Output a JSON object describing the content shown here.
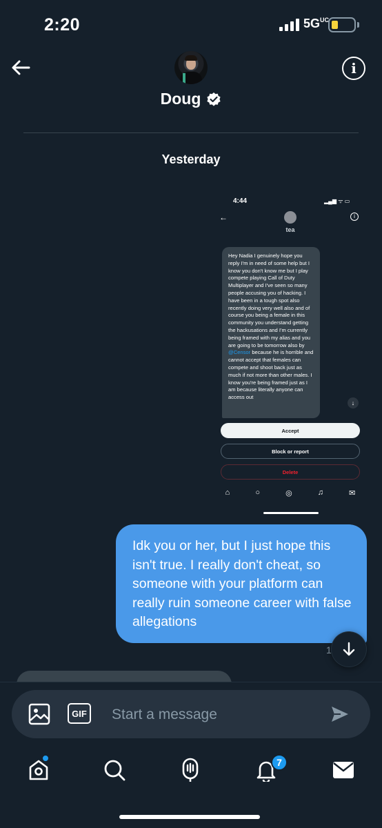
{
  "status_bar": {
    "time": "2:20",
    "network": "5G",
    "network_suffix": "UC"
  },
  "header": {
    "contact_name": "Doug",
    "verified": true
  },
  "conversation": {
    "day_label": "Yesterday",
    "attachment": {
      "status_time": "4:44",
      "contact_name": "tea",
      "message_before_mention": "Hey Nadia I genuinely hope you reply I'm in need of some help but I know you don't know me but I play compete playing Call of Duty Multiplayer and I've seen so many people accusing you of hacking. I have been in a tough spot also recently doing very well also and of course you being a female in this community you understand getting the hackusations and I'm currently being framed with my alias and you are going to be tomorrow also by ",
      "mention": "@Censor",
      "message_after_mention": " because he is horrible and cannot accept that females can compete and shoot back just as much if not more than other males. I know you're being framed just as I am because literally anyone can access out",
      "accept_label": "Accept",
      "block_label": "Block or report",
      "delete_label": "Delete"
    },
    "sent_message": "Idk you or her, but I just hope this isn't true. I really don't cheat, so someone with your platform can really ruin someone career with false allegations",
    "sent_time": "1:"
  },
  "composer": {
    "gif_label": "GIF",
    "placeholder": "Start a message"
  },
  "bottom_nav": {
    "notifications_badge": "7"
  },
  "colors": {
    "background": "#15202b",
    "bubble_sent": "#4a99e9",
    "accent": "#1d9bf0",
    "composer": "#273340"
  }
}
